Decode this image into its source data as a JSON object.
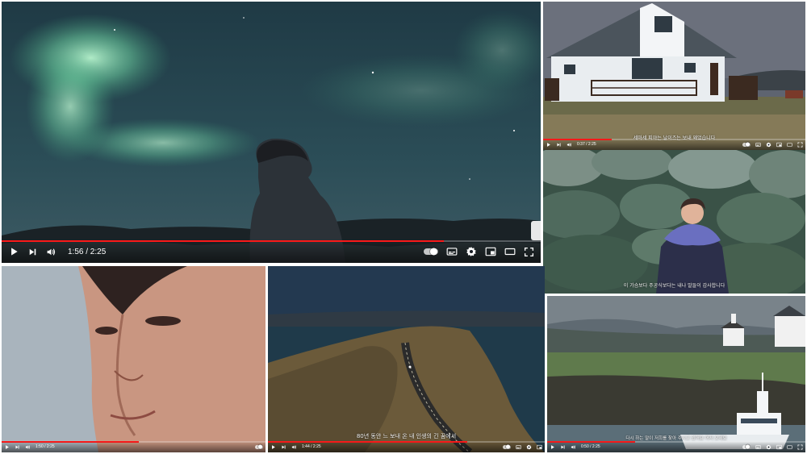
{
  "frames": {
    "aurora": {
      "time": "1:56 / 2:25",
      "progress": 0.82
    },
    "house": {
      "time": "0:37 / 2:25",
      "progress": 0.26,
      "caption": "세마세 피야는 날이즈는 보내 왜었습니다"
    },
    "moss": {
      "caption": "이 가슴보다 주공식보다는 내나 말들이 감사합니다"
    },
    "face": {
      "time": "1:50 / 2:25",
      "progress": 0.52
    },
    "road": {
      "time": "1:44 / 2:25",
      "progress": 0.72,
      "caption": "80년 동안 느 보내 온 내 인생의 긴 꿈에서"
    },
    "church": {
      "time": "0:50 / 2:25",
      "progress": 0.34,
      "caption": "다시 하는 말이 저희를 찾아 주시고 있어요 어서 오세요"
    }
  },
  "icons": {
    "play": "play-icon",
    "next": "next-icon",
    "volume": "volume-icon",
    "autoplay": "autoplay-toggle",
    "subtitles": "subtitles-icon",
    "settings": "gear-icon",
    "miniplayer": "miniplayer-icon",
    "theater": "theater-icon",
    "fullscreen": "fullscreen-icon"
  },
  "colors": {
    "progress": "#ff1a1a",
    "controls": "#ffffff"
  }
}
